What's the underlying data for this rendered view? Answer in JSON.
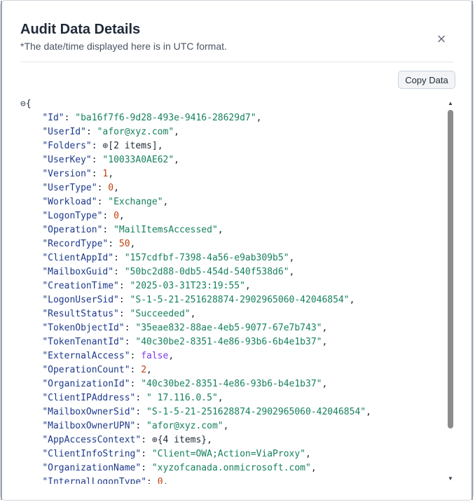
{
  "dialog": {
    "title": "Audit Data Details",
    "subtitle": "*The date/time displayed here is in UTC format.",
    "close_icon": "×",
    "copy_button": "Copy Data"
  },
  "json_view": {
    "collapse_icon": "⊖",
    "expand_icon": "⊕",
    "open_brace": "{",
    "entries": [
      {
        "key": "Id",
        "type": "string",
        "value": "ba16f7f6-9d28-493e-9416-28629d7"
      },
      {
        "key": "UserId",
        "type": "string",
        "value": "afor@xyz.com"
      },
      {
        "key": "Folders",
        "type": "collapsed",
        "value": "[2 items]"
      },
      {
        "key": "UserKey",
        "type": "string",
        "value": "10033A0AE62"
      },
      {
        "key": "Version",
        "type": "number",
        "value": "1"
      },
      {
        "key": "UserType",
        "type": "number",
        "value": "0"
      },
      {
        "key": "Workload",
        "type": "string",
        "value": "Exchange"
      },
      {
        "key": "LogonType",
        "type": "number",
        "value": "0"
      },
      {
        "key": "Operation",
        "type": "string",
        "value": "MailItemsAccessed"
      },
      {
        "key": "RecordType",
        "type": "number",
        "value": "50"
      },
      {
        "key": "ClientAppId",
        "type": "string",
        "value": "157cdfbf-7398-4a56-e9ab309b5"
      },
      {
        "key": "MailboxGuid",
        "type": "string",
        "value": "50bc2d88-0db5-454d-540f538d6"
      },
      {
        "key": "CreationTime",
        "type": "string",
        "value": "2025-03-31T23:19:55"
      },
      {
        "key": "LogonUserSid",
        "type": "string",
        "value": "S-1-5-21-251628874-2902965060-42046854"
      },
      {
        "key": "ResultStatus",
        "type": "string",
        "value": "Succeeded"
      },
      {
        "key": "TokenObjectId",
        "type": "string",
        "value": "35eae832-88ae-4eb5-9077-67e7b743"
      },
      {
        "key": "TokenTenantId",
        "type": "string",
        "value": "40c30be2-8351-4e86-93b6-6b4e1b37"
      },
      {
        "key": "ExternalAccess",
        "type": "bool",
        "value": "false"
      },
      {
        "key": "OperationCount",
        "type": "number",
        "value": "2"
      },
      {
        "key": "OrganizationId",
        "type": "string",
        "value": "40c30be2-8351-4e86-93b6-b4e1b37"
      },
      {
        "key": "ClientIPAddress",
        "type": "string",
        "value": " 17.116.0.5"
      },
      {
        "key": "MailboxOwnerSid",
        "type": "string",
        "value": "S-1-5-21-251628874-2902965060-42046854"
      },
      {
        "key": "MailboxOwnerUPN",
        "type": "string",
        "value": "afor@xyz.com"
      },
      {
        "key": "AppAccessContext",
        "type": "collapsed",
        "value": "{4 items}"
      },
      {
        "key": "ClientInfoString",
        "type": "string",
        "value": "Client=OWA;Action=ViaProxy"
      },
      {
        "key": "OrganizationName",
        "type": "string",
        "value": "xyzofcanada.onmicrosoft.com"
      },
      {
        "key": "InternalLogonType",
        "type": "number",
        "value": "0"
      }
    ]
  },
  "scrollbar": {
    "up_icon": "▲",
    "down_icon": "▼",
    "position": 0.0
  },
  "colors": {
    "key": "#1e3a8a",
    "string": "#16805f",
    "number": "#c2410c",
    "bool": "#7c3aed"
  }
}
